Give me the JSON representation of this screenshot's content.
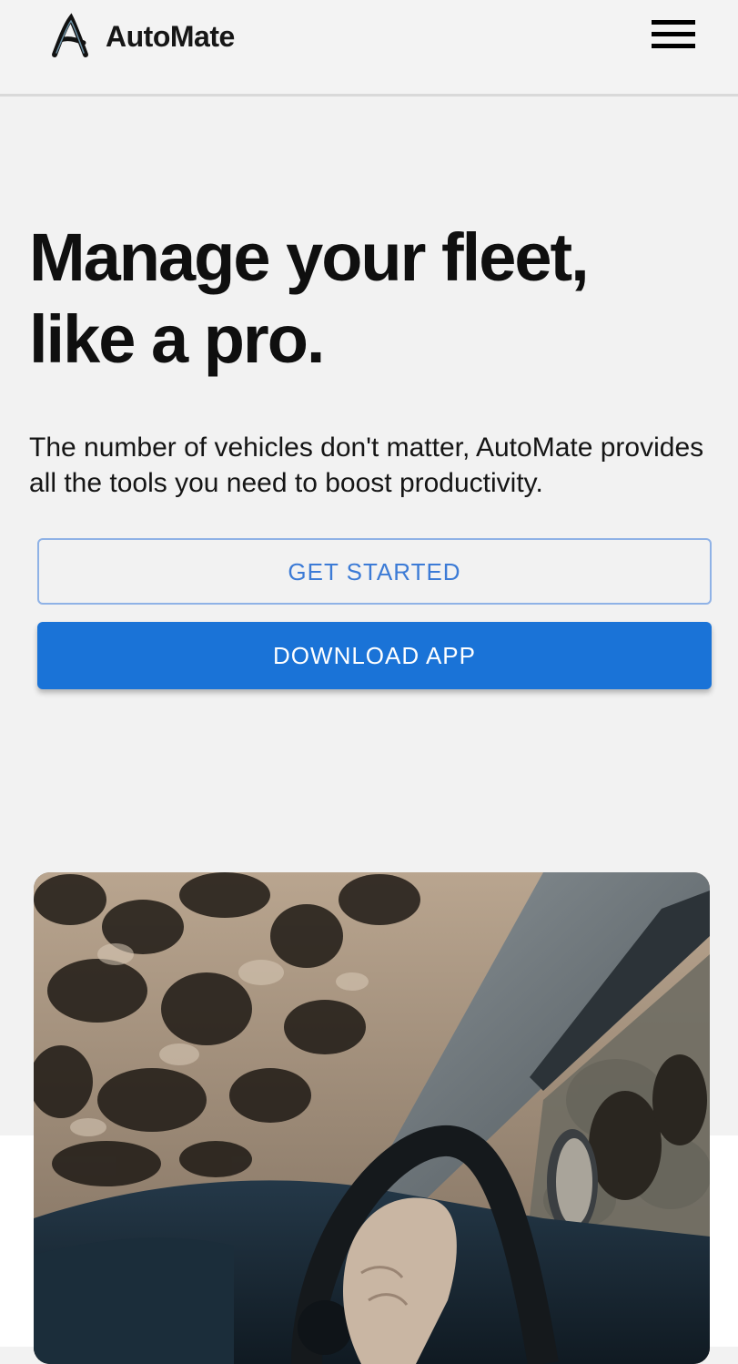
{
  "header": {
    "brand_name": "AutoMate",
    "logo_icon": "automate-logo-icon",
    "menu_icon": "hamburger-menu-icon"
  },
  "hero": {
    "title_line1": "Manage your fleet,",
    "title_line2": "like a pro.",
    "description": "The number of vehicles don't matter, AutoMate provides all the tools you need to boost productivity."
  },
  "actions": {
    "get_started_label": "GET STARTED",
    "download_app_label": "DOWNLOAD APP"
  },
  "colors": {
    "accent": "#1a73d7",
    "outline": "#8fb2e6",
    "page_background": "#f2f2f2"
  }
}
